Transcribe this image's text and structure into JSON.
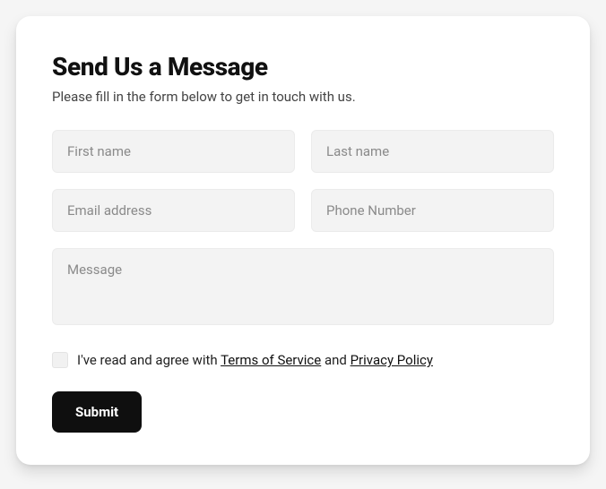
{
  "form": {
    "heading": "Send Us a Message",
    "subheading": "Please fill in the form below to get in touch with us.",
    "fields": {
      "first_name": {
        "placeholder": "First name",
        "value": ""
      },
      "last_name": {
        "placeholder": "Last name",
        "value": ""
      },
      "email": {
        "placeholder": "Email address",
        "value": ""
      },
      "phone": {
        "placeholder": "Phone Number",
        "value": ""
      },
      "message": {
        "placeholder": "Message",
        "value": ""
      }
    },
    "agreement": {
      "checked": false,
      "prefix": "I've read and agree with ",
      "terms_label": "Terms of Service",
      "middle": " and ",
      "privacy_label": "Privacy Policy"
    },
    "submit_label": "Submit"
  }
}
